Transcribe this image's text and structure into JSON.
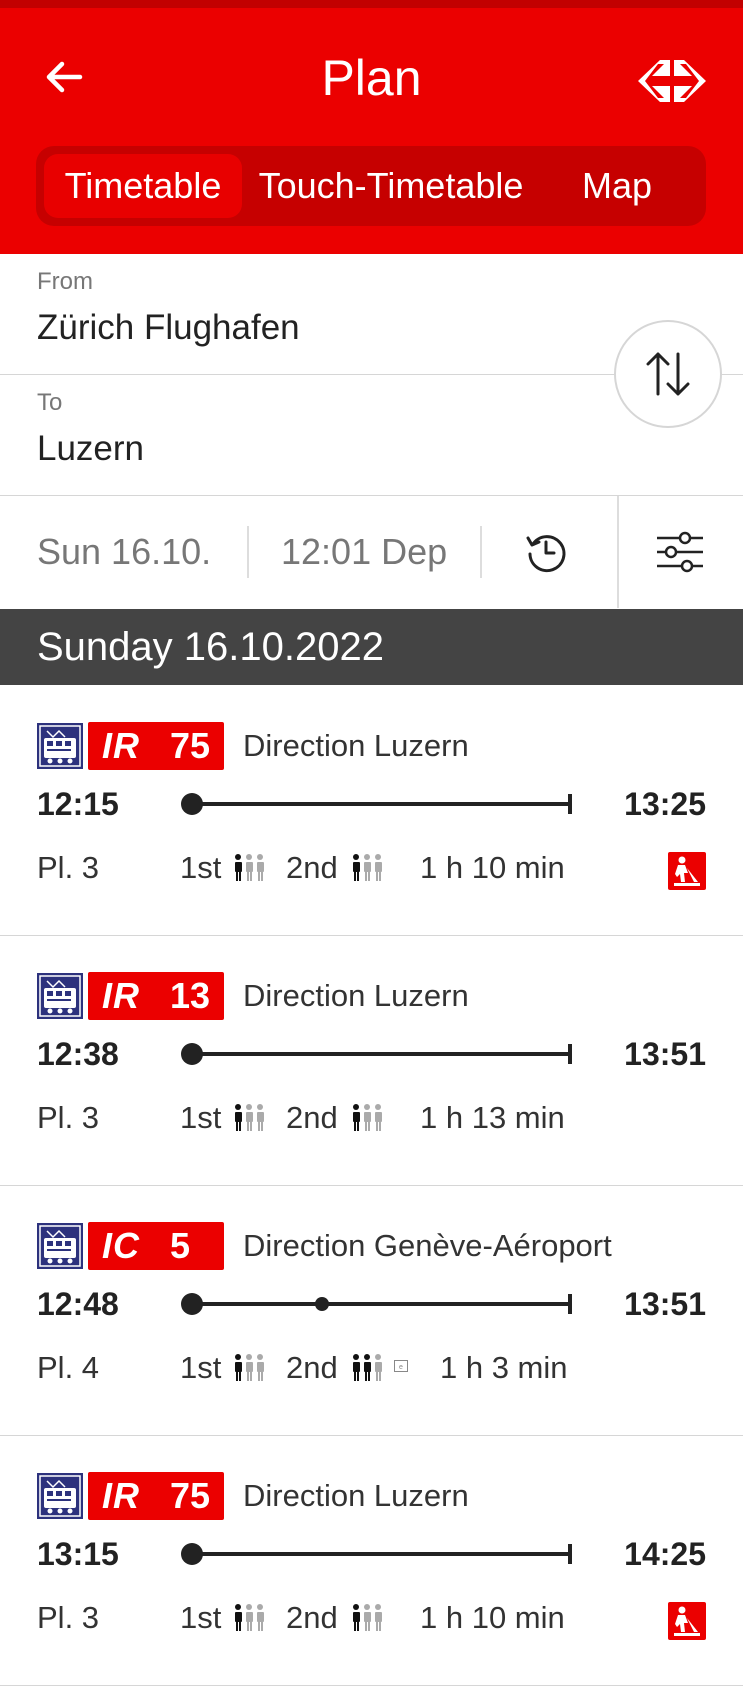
{
  "header": {
    "title": "Plan",
    "tabs": [
      {
        "label": "Timetable",
        "active": true
      },
      {
        "label": "Touch-Timetable",
        "active": false
      },
      {
        "label": "Map",
        "active": false
      }
    ]
  },
  "form": {
    "from_label": "From",
    "from_value": "Zürich Flughafen",
    "to_label": "To",
    "to_value": "Luzern",
    "date": "Sun 16.10.",
    "time": "12:01 Dep"
  },
  "day_header": "Sunday 16.10.2022",
  "connections": [
    {
      "category": "IR",
      "number": "75",
      "direction": "Direction Luzern",
      "dep": "12:15",
      "arr": "13:25",
      "platform": "Pl. 3",
      "first": "1st",
      "second": "2nd",
      "duration": "1 h 10 min",
      "construction_warning": true
    },
    {
      "category": "IR",
      "number": "13",
      "direction": "Direction Luzern",
      "dep": "12:38",
      "arr": "13:51",
      "platform": "Pl. 3",
      "first": "1st",
      "second": "2nd",
      "duration": "1 h 13 min",
      "construction_warning": false
    },
    {
      "category": "IC",
      "number": "5",
      "direction": "Direction Genève-Aéroport",
      "dep": "12:48",
      "arr": "13:51",
      "platform": "Pl. 4",
      "first": "1st",
      "second": "2nd",
      "duration": "1 h 3 min",
      "construction_warning": false
    },
    {
      "category": "IR",
      "number": "75",
      "direction": "Direction Luzern",
      "dep": "13:15",
      "arr": "14:25",
      "platform": "Pl. 3",
      "first": "1st",
      "second": "2nd",
      "duration": "1 h 10 min",
      "construction_warning": true
    }
  ],
  "colors": {
    "brand_red": "#eb0000",
    "day_header_bg": "#444444",
    "train_icon_blue": "#2d327d"
  }
}
